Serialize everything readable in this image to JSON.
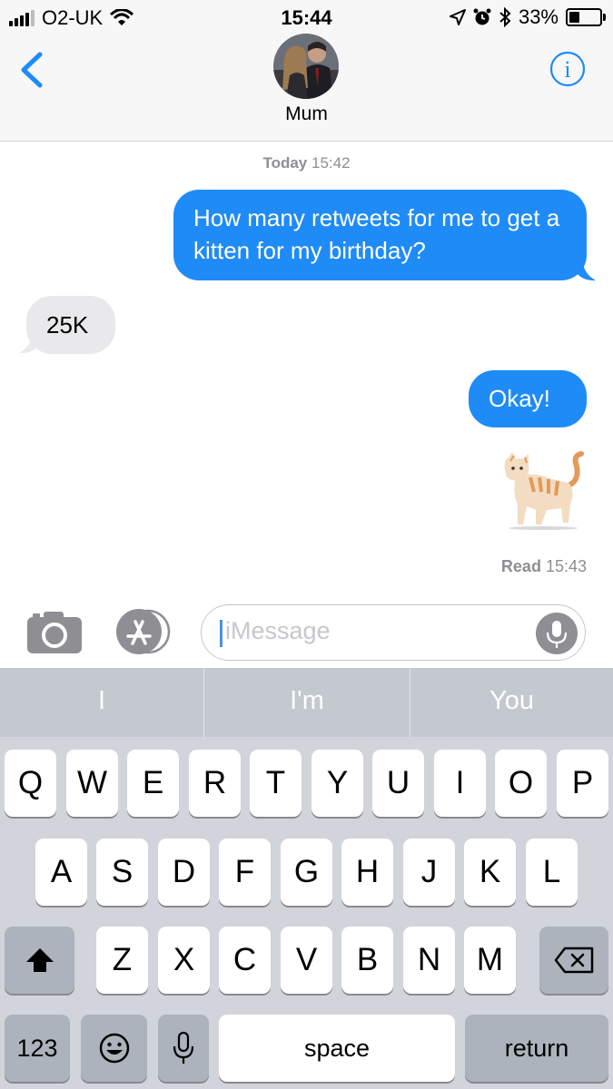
{
  "status_bar": {
    "carrier": "O2-UK",
    "time": "15:44",
    "battery": "33%",
    "battery_level": 0.33
  },
  "header": {
    "contact_name": "Mum"
  },
  "conversation": {
    "timestamp_day": "Today",
    "timestamp_time": "15:42",
    "messages": [
      {
        "direction": "outgoing",
        "text": "How many retweets for me to get a kitten for my birthday?"
      },
      {
        "direction": "incoming",
        "text": "25K"
      },
      {
        "direction": "outgoing",
        "text": "Okay!"
      },
      {
        "direction": "outgoing",
        "emoji": "cat",
        "text": "🐈"
      }
    ],
    "read_label": "Read",
    "read_time": "15:43"
  },
  "composer": {
    "placeholder": "iMessage"
  },
  "keyboard": {
    "predictions": [
      "I",
      "I'm",
      "You"
    ],
    "row1": [
      "Q",
      "W",
      "E",
      "R",
      "T",
      "Y",
      "U",
      "I",
      "O",
      "P"
    ],
    "row2": [
      "A",
      "S",
      "D",
      "F",
      "G",
      "H",
      "J",
      "K",
      "L"
    ],
    "row3": [
      "Z",
      "X",
      "C",
      "V",
      "B",
      "N",
      "M"
    ],
    "numbers_label": "123",
    "space_label": "space",
    "return_label": "return"
  }
}
